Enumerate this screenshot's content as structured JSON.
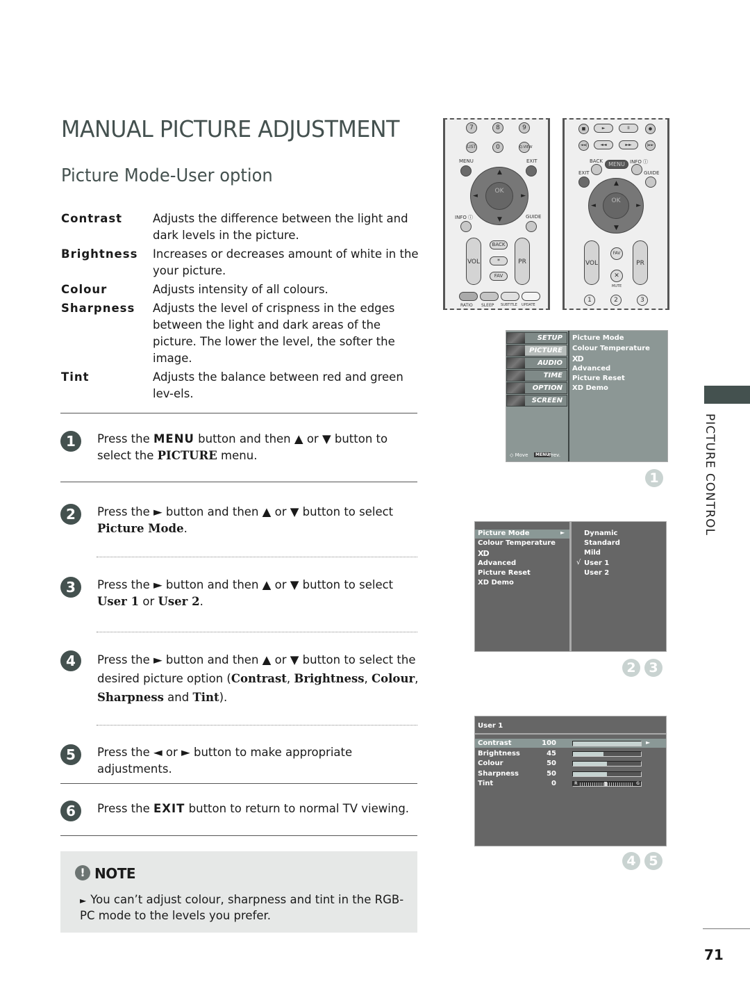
{
  "page": {
    "title": "MANUAL PICTURE ADJUSTMENT",
    "subtitle": "Picture Mode-User option",
    "section_tab": "PICTURE CONTROL",
    "page_number": "71"
  },
  "definitions": [
    {
      "term": "Contrast",
      "desc": "Adjusts the difference between the light and dark levels in the picture."
    },
    {
      "term": "Brightness",
      "desc": "Increases or decreases amount of white in the your picture."
    },
    {
      "term": "Colour",
      "desc": "Adjusts intensity of all colours."
    },
    {
      "term": "Sharpness",
      "desc": "Adjusts the level of crispness in the edges between the light and dark areas of the picture. The lower the level, the softer the image."
    },
    {
      "term": "Tint",
      "desc": "Adjusts the balance between red and green lev-els."
    }
  ],
  "steps": [
    {
      "num": "1",
      "parts": [
        "Press the ",
        "MENU",
        " button and then ▲ or ▼ button to select the ",
        "PICTURE",
        " menu."
      ]
    },
    {
      "num": "2",
      "parts": [
        "Press the ► button and then ▲ or ▼ button to select ",
        "Picture Mode",
        "."
      ]
    },
    {
      "num": "3",
      "parts": [
        "Press the ► button and then ▲ or ▼ button to select ",
        "User 1",
        " or ",
        "User 2",
        "."
      ]
    },
    {
      "num": "4",
      "parts": [
        "Press the ► button and then ▲ or ▼ button to select the desired picture option (",
        "Contrast",
        ", ",
        "Brightness",
        ", ",
        "Colour",
        ", ",
        "Sharpness",
        " and ",
        "Tint",
        ")."
      ]
    },
    {
      "num": "5",
      "parts": [
        "Press the ◄ or ► button to make appropriate adjustments."
      ]
    },
    {
      "num": "6",
      "parts": [
        "Press the ",
        "EXIT",
        " button to return to normal TV viewing."
      ]
    }
  ],
  "note": {
    "title": "NOTE",
    "icon": "exclamation-icon",
    "text": "You can’t adjust colour, sharpness and tint in the RGB-PC mode to the levels you prefer."
  },
  "remote_left": {
    "numbers": [
      "7",
      "8",
      "9",
      "LIST",
      "0",
      "Q.VIEW"
    ],
    "menu": "MENU",
    "exit": "EXIT",
    "ok": "OK",
    "info": "INFO ⓘ",
    "guide": "GUIDE",
    "vol": "VOL",
    "pr": "PR",
    "back": "BACK",
    "star": "*",
    "fav": "FAV",
    "color_keys": [
      "RATIO",
      "SLEEP",
      "SUBTITLE",
      "UPDATE"
    ]
  },
  "remote_right": {
    "transport": [
      "■",
      "►",
      "II",
      "●",
      "◄◄|",
      "◄◄",
      "►►",
      "|►►"
    ],
    "back": "BACK",
    "menu": "MENU",
    "info": "INFO ⓘ",
    "exit": "EXIT",
    "guide": "GUIDE",
    "ok": "OK",
    "vol": "VOL",
    "pr": "PR",
    "fav": "FAV",
    "mute": "MUTE",
    "numbers": [
      "1",
      "2",
      "3"
    ]
  },
  "osd_main": {
    "tabs": [
      "SETUP",
      "PICTURE",
      "AUDIO",
      "TIME",
      "OPTION",
      "SCREEN"
    ],
    "selected_tab": "PICTURE",
    "items": [
      "Picture Mode",
      "Colour Temperature",
      "XD",
      "Advanced",
      "Picture Reset",
      "XD Demo"
    ],
    "footer_move": "◇ Move",
    "footer_menu": "MENU",
    "footer_prev": "Prev.",
    "step_badge": "1"
  },
  "osd_mode": {
    "items": [
      "Picture Mode",
      "Colour Temperature",
      "XD",
      "Advanced",
      "Picture Reset",
      "XD Demo"
    ],
    "options": [
      "Dynamic",
      "Standard",
      "Mild",
      "User 1",
      "User 2"
    ],
    "checked": "User 1",
    "check_mark": "√",
    "step_badges": [
      "2",
      "3"
    ]
  },
  "osd_user": {
    "title": "User 1",
    "settings": [
      {
        "label": "Contrast",
        "value": "100",
        "level": 100
      },
      {
        "label": "Brightness",
        "value": "45",
        "level": 45
      },
      {
        "label": "Colour",
        "value": "50",
        "level": 50
      },
      {
        "label": "Sharpness",
        "value": "50",
        "level": 50
      },
      {
        "label": "Tint",
        "value": "0",
        "level": 0
      }
    ],
    "tint_left": "R",
    "tint_right": "G",
    "step_badges": [
      "4",
      "5"
    ]
  }
}
